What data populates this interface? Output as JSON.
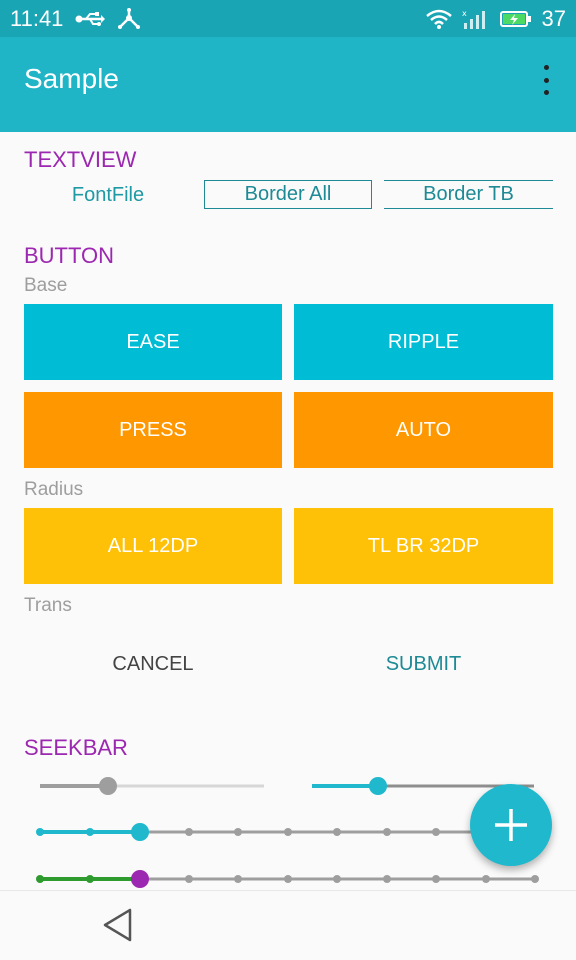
{
  "status_bar": {
    "time": "11:41",
    "battery": "37"
  },
  "app_bar": {
    "title": "Sample",
    "overflow_icon": "more-vertical-icon"
  },
  "textview": {
    "title": "TEXTVIEW",
    "font_file": "FontFile",
    "border_all": "Border All",
    "border_tb": "Border TB"
  },
  "button": {
    "title": "BUTTON",
    "base_label": "Base",
    "ease": "EASE",
    "ripple": "RIPPLE",
    "press": "PRESS",
    "auto": "AUTO",
    "radius_label": "Radius",
    "all_12dp": "ALL 12DP",
    "tl_br_32dp": "TL BR 32DP",
    "trans_label": "Trans",
    "cancel": "CANCEL",
    "submit": "SUBMIT"
  },
  "seekbar": {
    "title": "SEEKBAR",
    "seekbar_1_value": 0.3,
    "seekbar_2_value": 0.3,
    "seekbar_3_value": 0.2,
    "seekbar_4_value": 0.2
  },
  "colors": {
    "primary": "#1fb4c6",
    "accent_purple": "#9c27b0",
    "cyan": "#00bcd4",
    "orange": "#ff9800",
    "amber": "#ffc107",
    "green": "#2e9b2e"
  }
}
